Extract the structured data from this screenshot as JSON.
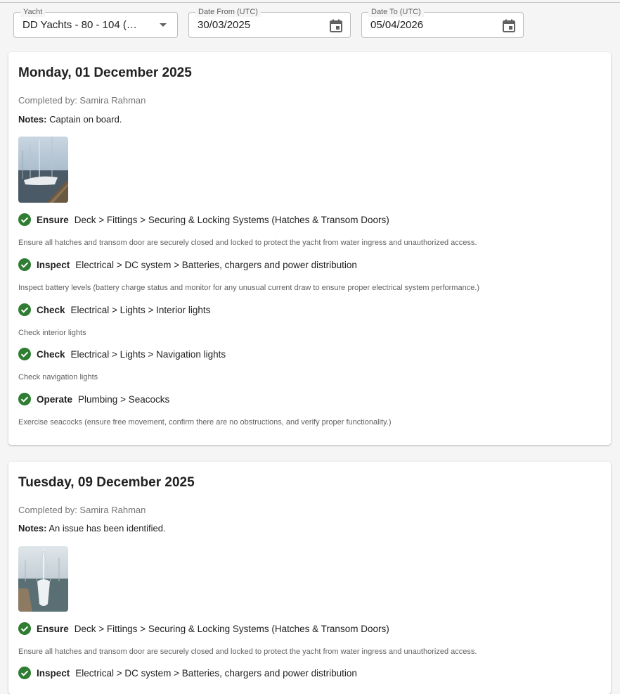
{
  "filters": {
    "yacht": {
      "label": "Yacht",
      "value": "DD Yachts - 80 - 104 (…"
    },
    "date_from": {
      "label": "Date From (UTC)",
      "value": "30/03/2025"
    },
    "date_to": {
      "label": "Date To (UTC)",
      "value": "05/04/2026"
    }
  },
  "icons": {
    "dropdown": "chevron-down-icon",
    "calendar": "calendar-icon",
    "check": "check-circle-icon"
  },
  "colors": {
    "check_green": "#2e7d32"
  },
  "entries": [
    {
      "date": "Monday, 01 December 2025",
      "completed_by": "Completed by: Samira Rahman",
      "notes_label": "Notes:",
      "notes": "Captain on board.",
      "tasks": [
        {
          "verb": "Ensure",
          "path": "Deck > Fittings > Securing & Locking Systems (Hatches & Transom Doors)",
          "description": "Ensure all hatches and transom door are securely closed and locked to protect the yacht from water ingress and unauthorized access."
        },
        {
          "verb": "Inspect",
          "path": "Electrical > DC system > Batteries, chargers and power distribution",
          "description": "Inspect battery levels (battery charge status and monitor for any unusual current draw to ensure proper electrical system performance.)"
        },
        {
          "verb": "Check",
          "path": "Electrical > Lights > Interior lights",
          "description": "Check interior lights"
        },
        {
          "verb": "Check",
          "path": "Electrical > Lights > Navigation lights",
          "description": "Check navigation lights"
        },
        {
          "verb": "Operate",
          "path": "Plumbing > Seacocks",
          "description": "Exercise seacocks (ensure free movement, confirm there are no obstructions, and verify proper functionality.)"
        }
      ]
    },
    {
      "date": "Tuesday, 09 December 2025",
      "completed_by": "Completed by: Samira Rahman",
      "notes_label": "Notes:",
      "notes": "An issue has been identified.",
      "tasks": [
        {
          "verb": "Ensure",
          "path": "Deck > Fittings > Securing & Locking Systems (Hatches & Transom Doors)",
          "description": "Ensure all hatches and transom door are securely closed and locked to protect the yacht from water ingress and unauthorized access."
        },
        {
          "verb": "Inspect",
          "path": "Electrical > DC system > Batteries, chargers and power distribution"
        }
      ]
    }
  ]
}
